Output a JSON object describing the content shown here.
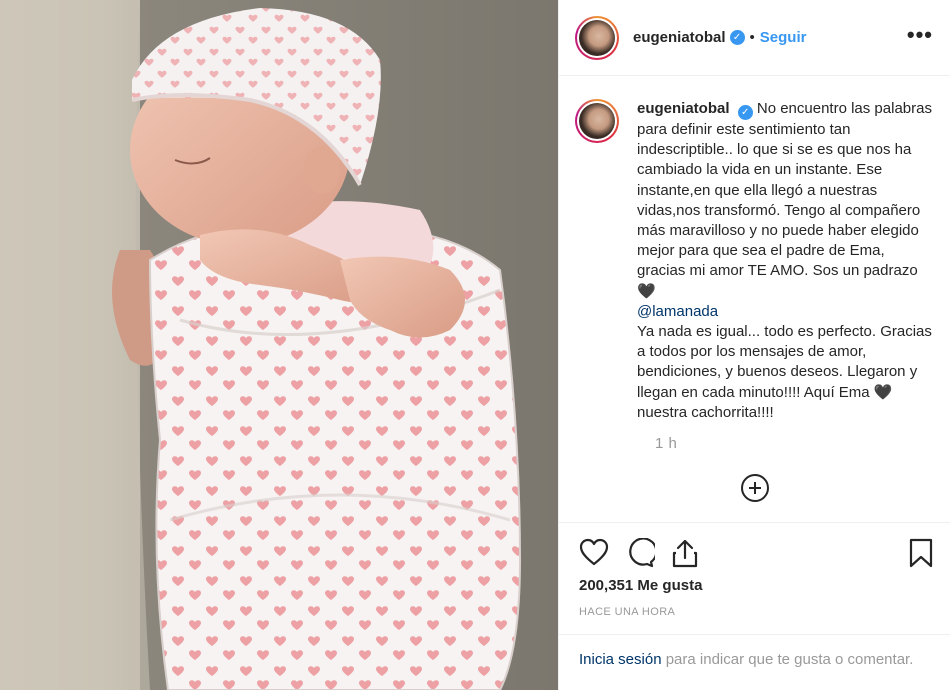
{
  "photo": {
    "alt_icon": "newborn-photo"
  },
  "header": {
    "username": "eugeniatobal",
    "verified_mark": "✓",
    "separator": "•",
    "follow_label": "Seguir",
    "more_label": "•••"
  },
  "caption": {
    "username": "eugeniatobal",
    "verified_mark": "✓",
    "text_before_mention": "No encuentro las palabras para definir este sentimiento tan indescriptible.. lo que si se es que nos ha cambiado la vida en un instante. Ese instante,en que ella llegó a nuestras vidas,nos transformó. Tengo al compañero más maravilloso y no puede haber elegido mejor para que sea el padre de Ema, gracias mi amor TE AMO. Sos un padrazo🖤",
    "mention": "@lamanada",
    "text_after_mention": "Ya nada es igual... todo es perfecto. Gracias a todos por los mensajes de amor, bendiciones, y buenos deseos. Llegaron y llegan en cada minuto!!!! Aquí Ema 🖤 nuestra cachorrita!!!!",
    "time": "1 h"
  },
  "actions": {
    "like_icon": "heart-icon",
    "comment_icon": "comment-icon",
    "share_icon": "share-icon",
    "save_icon": "bookmark-icon"
  },
  "likes": {
    "count": "200,351",
    "label": "Me gusta"
  },
  "posted": "HACE UNA HORA",
  "login": {
    "link": "Inicia sesión",
    "text": "para indicar que te gusta o comentar."
  },
  "colors": {
    "accent": "#3897f0",
    "link": "#003569",
    "muted": "#999999"
  }
}
